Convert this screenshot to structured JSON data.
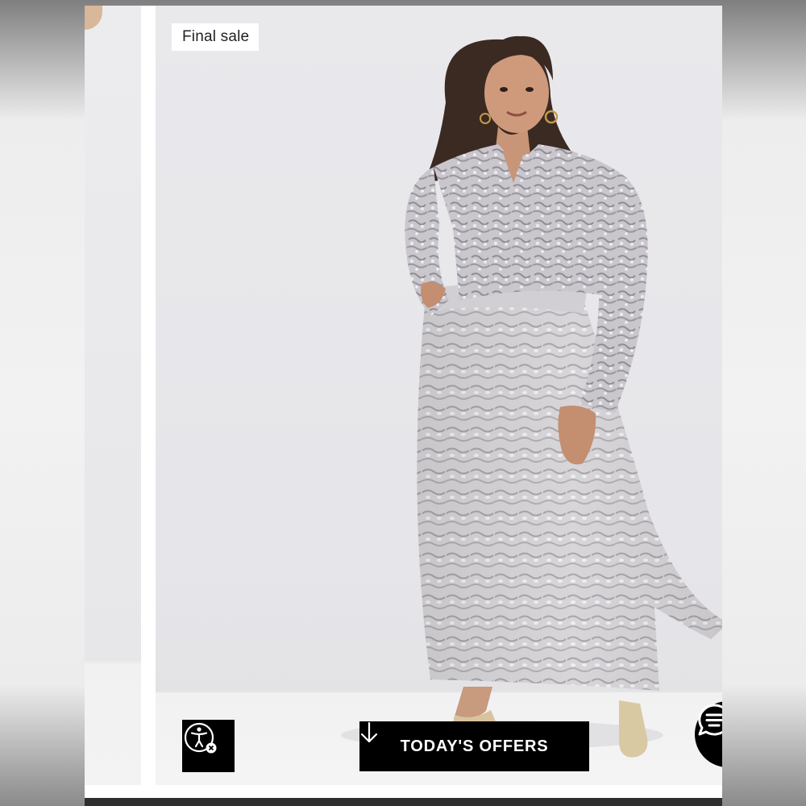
{
  "product": {
    "badge": "Final sale",
    "image_alt": "Model wearing snake print blouse and pleated maxi skirt"
  },
  "actions": {
    "offers_label": "TODAY'S OFFERS",
    "offers_icon": "arrow-down-icon",
    "accessibility_icon": "accessibility-icon",
    "chat_icon": "chat-icon"
  },
  "colors": {
    "button_bg": "#000000",
    "button_text": "#ffffff",
    "backdrop": "#e8e8eb"
  }
}
